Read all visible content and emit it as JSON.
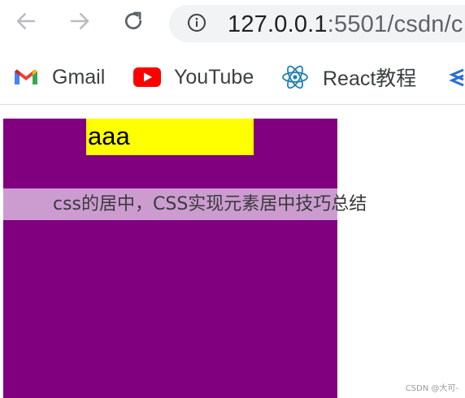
{
  "browser": {
    "url_host": "127.0.0.1",
    "url_path": ":5501/csdn/c",
    "back_icon": "arrow-left-icon",
    "forward_icon": "arrow-right-icon",
    "reload_icon": "reload-icon",
    "info_icon": "info-icon"
  },
  "bookmarks": [
    {
      "label": "Gmail",
      "icon": "gmail-icon"
    },
    {
      "label": "YouTube",
      "icon": "youtube-icon"
    },
    {
      "label": "React教程",
      "icon": "react-icon"
    }
  ],
  "page": {
    "yellow_box_text": "aaa",
    "colors": {
      "outer_box": "#800080",
      "inner_box": "#ffff00"
    }
  },
  "overlay": {
    "title": "css的居中，CSS实现元素居中技巧总结",
    "credit": "CSDN @大可-"
  }
}
